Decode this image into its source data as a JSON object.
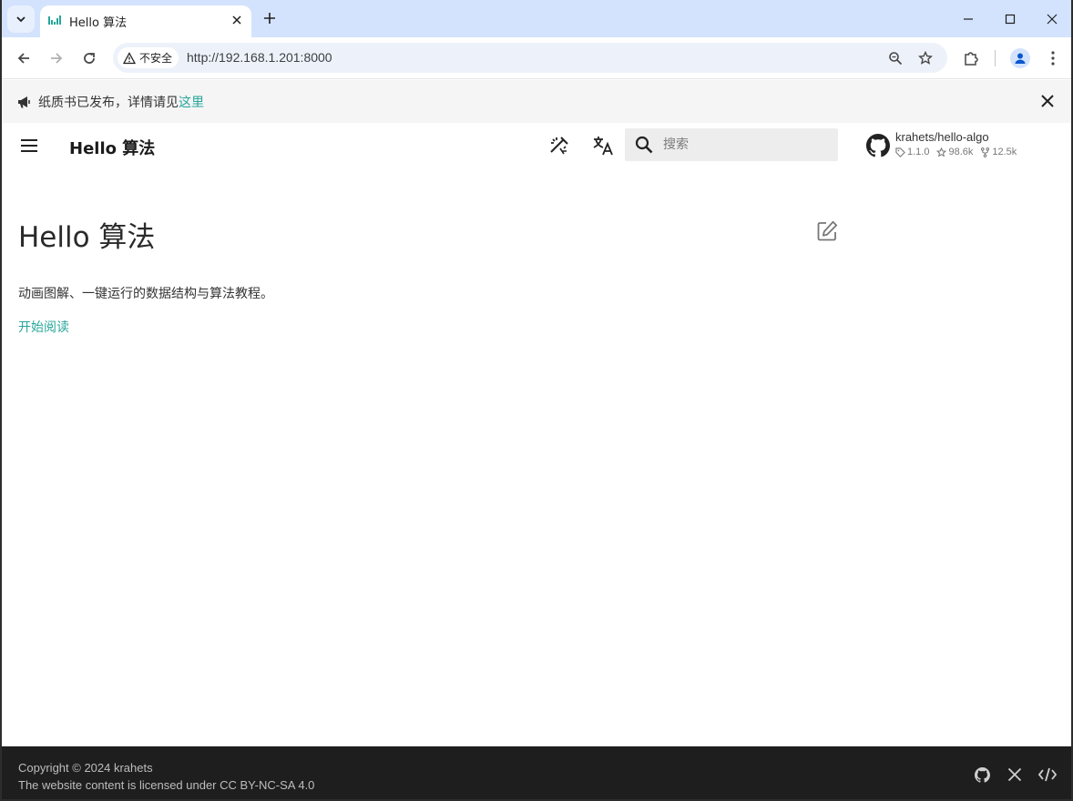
{
  "browser": {
    "tab": {
      "title": "Hello 算法"
    },
    "address_bar": {
      "security_label": "不安全",
      "url": "http://192.168.1.201:8000"
    }
  },
  "announcement": {
    "text": "纸质书已发布，详情请见",
    "link_text": "这里"
  },
  "header": {
    "site_title": "Hello 算法",
    "search": {
      "placeholder": "搜索"
    },
    "repo": {
      "name": "krahets/hello-algo",
      "version": "1.1.0",
      "stars": "98.6k",
      "forks": "12.5k"
    }
  },
  "main": {
    "title": "Hello 算法",
    "description": "动画图解、一键运行的数据结构与算法教程。",
    "start_link": "开始阅读"
  },
  "footer": {
    "copyright": "Copyright © 2024 krahets",
    "license": "The website content is licensed under CC BY-NC-SA 4.0"
  },
  "colors": {
    "accent": "#26a69a",
    "tabstrip": "#d3e3fd",
    "footer_bg": "#1e1e1e"
  }
}
